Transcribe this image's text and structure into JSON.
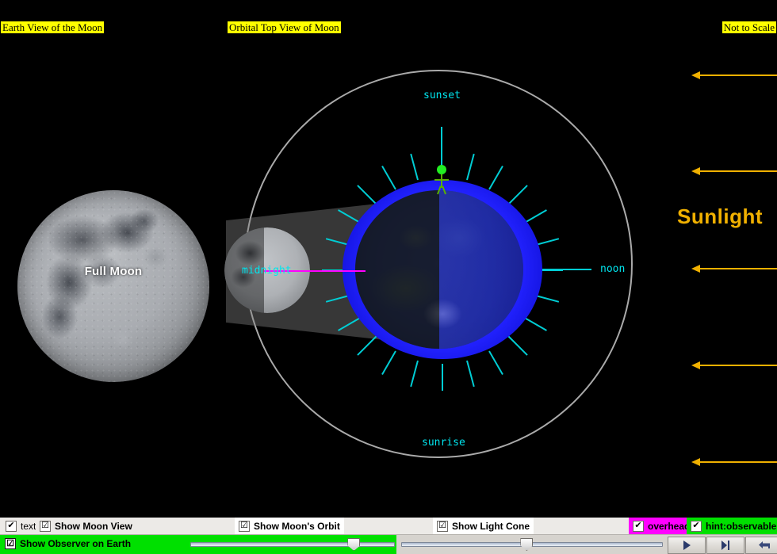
{
  "panels": {
    "earth_view_label": "Earth View of the Moon",
    "orbital_view_label": "Orbital Top View of Moon",
    "not_to_scale_label": "Not to Scale"
  },
  "moon_view": {
    "phase_label": "Full Moon"
  },
  "orbital_view": {
    "sunlight_label": "Sunlight",
    "midnight_label": "midnight",
    "time_markers": {
      "sunset": "sunset",
      "noon": "noon",
      "sunrise": "sunrise"
    }
  },
  "colors": {
    "highlight_yellow": "#ffff00",
    "sunlight_amber": "#f0b000",
    "cyan": "#00cdd4",
    "magenta": "#ff00ff",
    "green": "#00e000",
    "observer_green": "#22ee22",
    "earth_blue": "#2222ff",
    "stage_background": "#000000"
  },
  "controls": {
    "checkboxes": [
      {
        "id": "text",
        "label": "text",
        "checked": true,
        "bold": false,
        "glyph": "✔",
        "background": "#eceae7"
      },
      {
        "id": "moon-view",
        "label": "Show Moon View",
        "checked": true,
        "bold": true,
        "glyph": "☑",
        "background": "#eceae7"
      },
      {
        "id": "moon-orbit",
        "label": "Show Moon's Orbit",
        "checked": true,
        "bold": true,
        "glyph": "☑",
        "background": "#ffffff"
      },
      {
        "id": "light-cone",
        "label": "Show Light Cone",
        "checked": true,
        "bold": true,
        "glyph": "☑",
        "background": "#ffffff"
      },
      {
        "id": "overhead",
        "label": "overhead",
        "checked": true,
        "bold": true,
        "glyph": "✔",
        "background": "#ff00ff"
      },
      {
        "id": "hint",
        "label": "hint:observable?",
        "checked": true,
        "bold": true,
        "glyph": "✔",
        "background": "#00e000"
      }
    ],
    "observer_toggle": {
      "label": "Show Observer on Earth",
      "checked": true,
      "glyph": "☑"
    },
    "sliders": [
      {
        "id": "moon-phase-slider",
        "value_percent": 80
      },
      {
        "id": "time-slider",
        "value_percent": 48
      }
    ],
    "transport_buttons": [
      {
        "id": "play",
        "name": "play-button",
        "icon": "play-icon"
      },
      {
        "id": "step",
        "name": "step-button",
        "icon": "step-forward-icon"
      },
      {
        "id": "reset",
        "name": "reset-button",
        "icon": "back-arrow-icon"
      }
    ]
  }
}
